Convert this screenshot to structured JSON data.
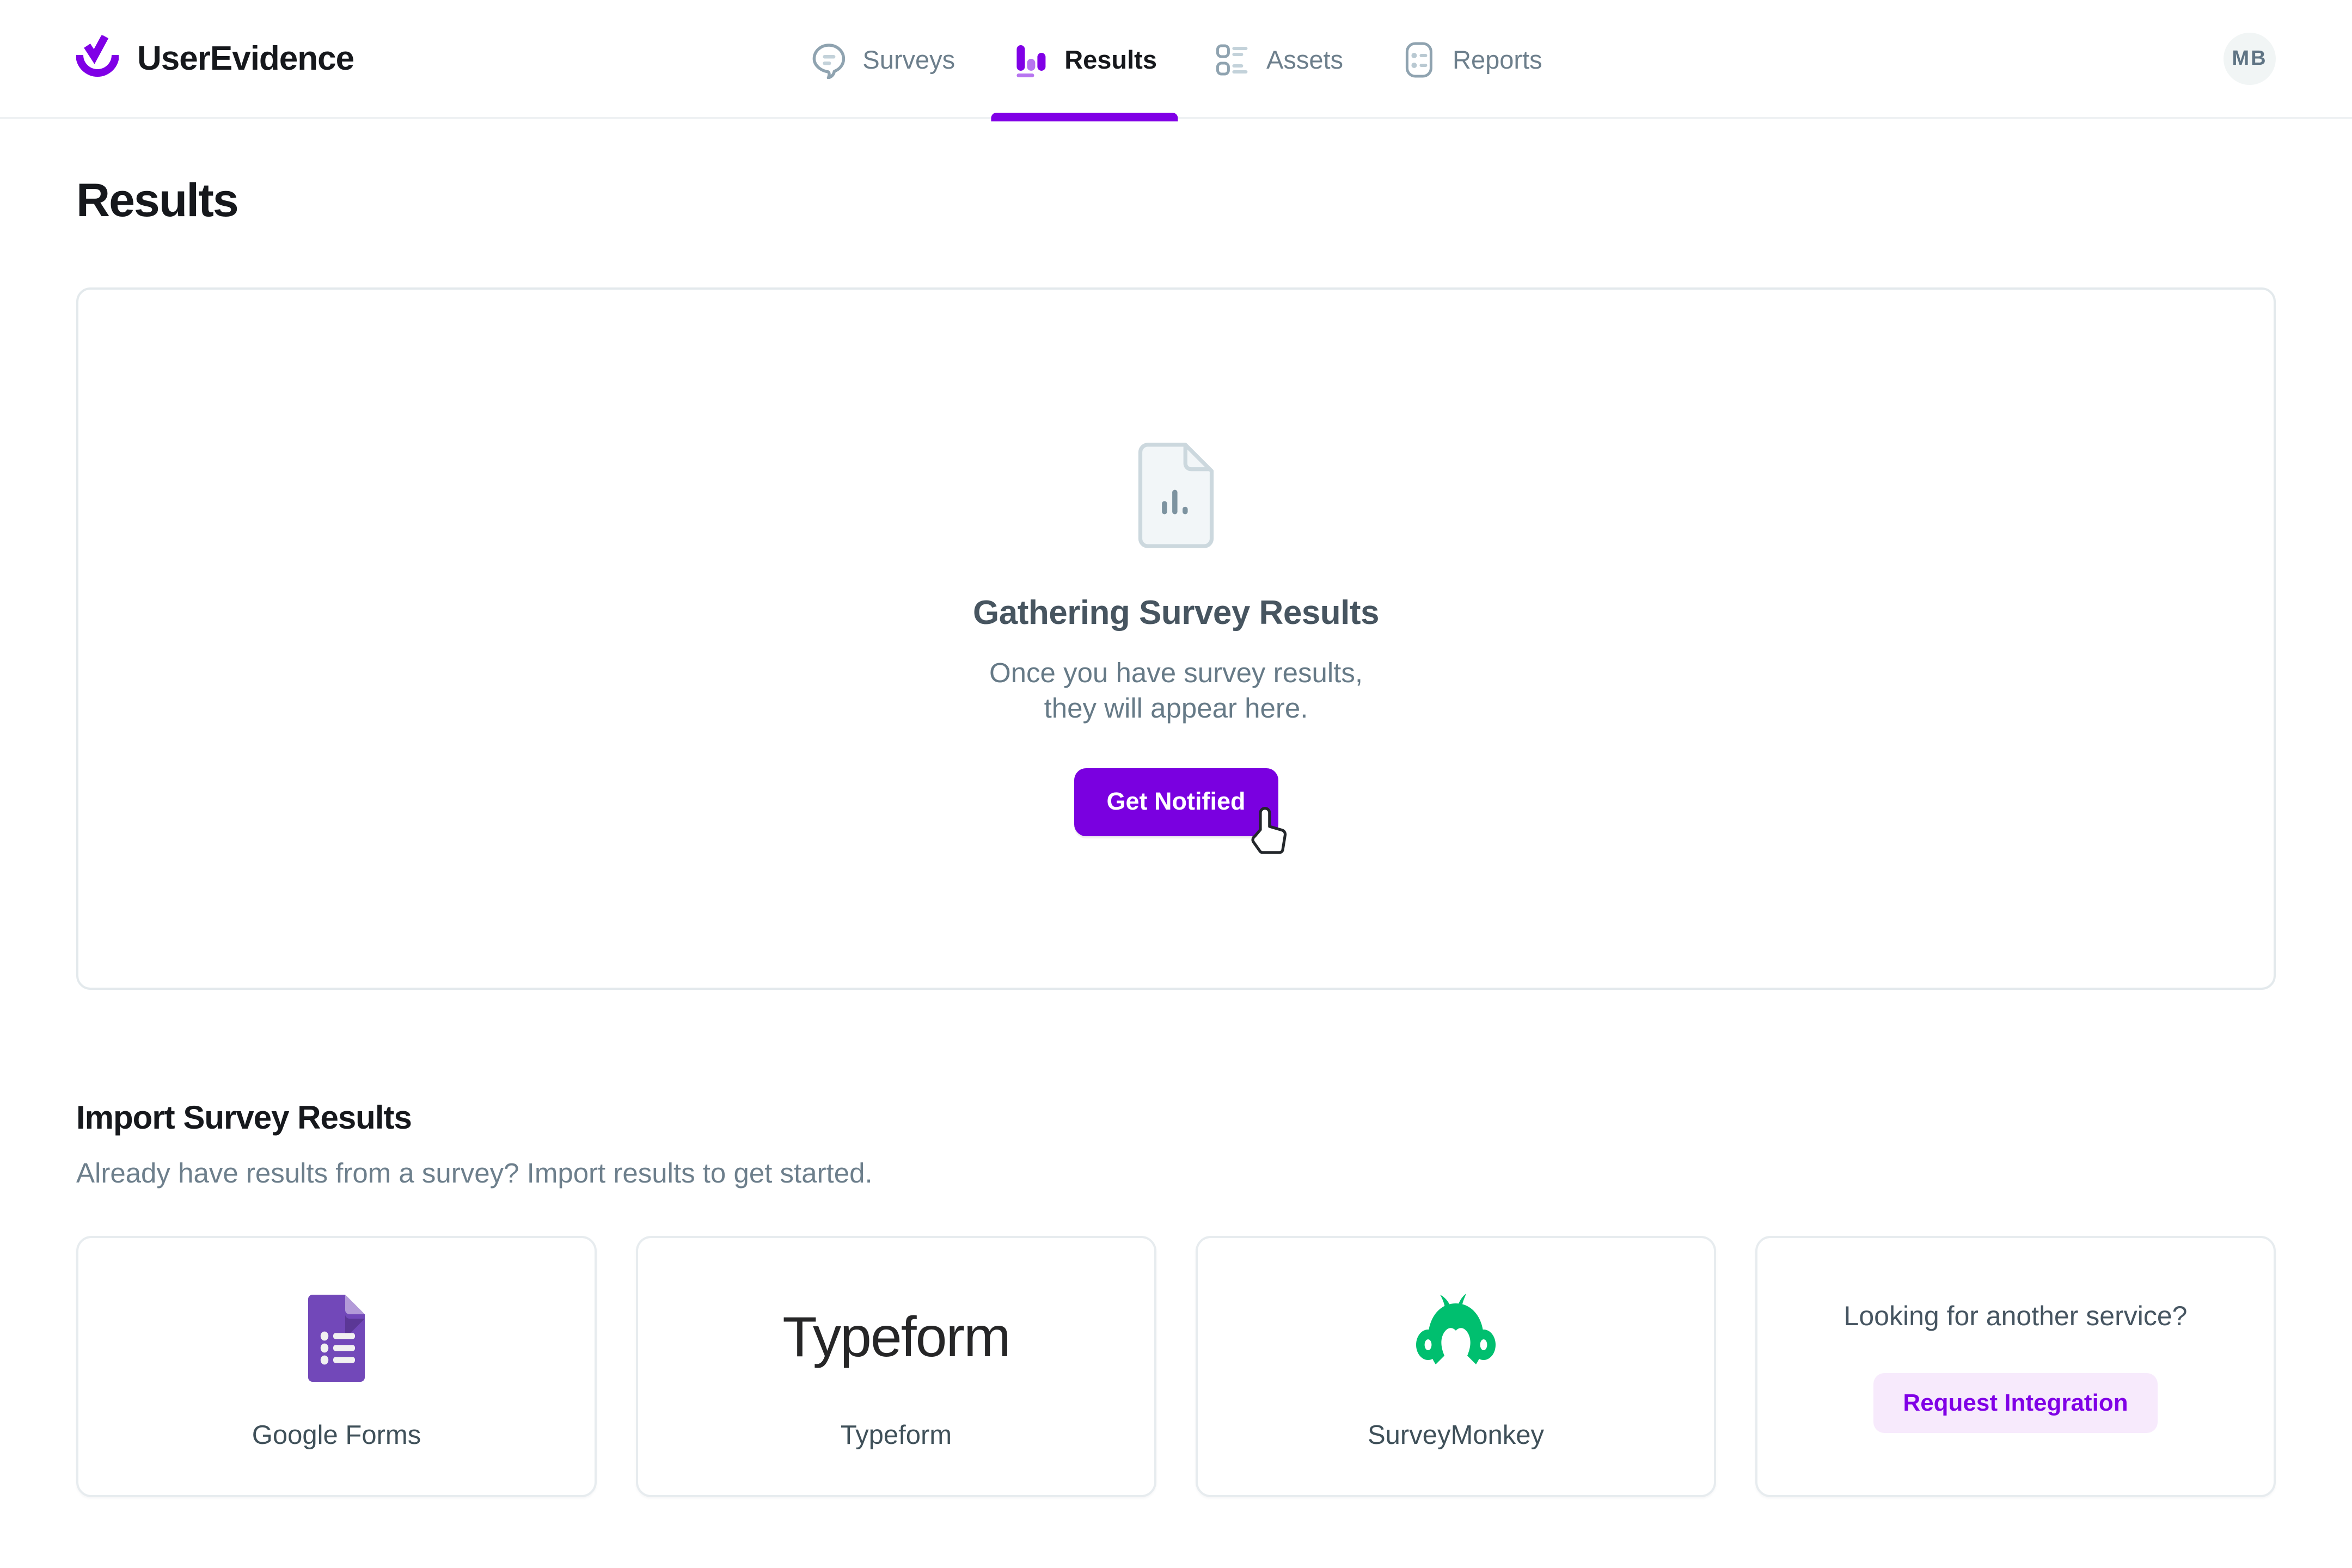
{
  "brand": {
    "name": "UserEvidence",
    "logo_icon": "checkmark-in-arc-logo",
    "accent_color": "#8000e6"
  },
  "nav": {
    "items": [
      {
        "label": "Surveys",
        "icon": "speech-bubble-survey-icon",
        "active": false
      },
      {
        "label": "Results",
        "icon": "bar-chart-results-icon",
        "active": true
      },
      {
        "label": "Assets",
        "icon": "checklist-assets-icon",
        "active": false
      },
      {
        "label": "Reports",
        "icon": "document-reports-icon",
        "active": false
      }
    ],
    "active_underline_color": "#8000e6"
  },
  "account": {
    "avatar_initials": "MB",
    "avatar_bg": "#f1f5f5",
    "avatar_text_color": "#5f7484"
  },
  "page": {
    "title": "Results"
  },
  "empty_state": {
    "icon": "document-bar-chart-icon",
    "title": "Gathering Survey Results",
    "description_line_1": "Once you have survey results,",
    "description_line_2": "they will appear here.",
    "button_label": "Get Notified",
    "button_color": "#7a00e0",
    "cursor": "pointing-hand-cursor"
  },
  "import_section": {
    "heading": "Import Survey Results",
    "subheading": "Already have results from a survey? Import results to get started.",
    "cards": [
      {
        "label": "Google Forms",
        "art": "google-forms-icon",
        "art_color": "#7248b9",
        "wordmark": null
      },
      {
        "label": "Typeform",
        "art": "typeform-wordmark",
        "art_color": "#262627",
        "wordmark": "Typeform"
      },
      {
        "label": "SurveyMonkey",
        "art": "surveymonkey-icon",
        "art_color": "#00bf6f",
        "wordmark": null
      }
    ],
    "request_card": {
      "prompt": "Looking for another service?",
      "button_label": "Request Integration",
      "button_bg": "#f7eafc",
      "button_text_color": "#8000e6"
    }
  }
}
